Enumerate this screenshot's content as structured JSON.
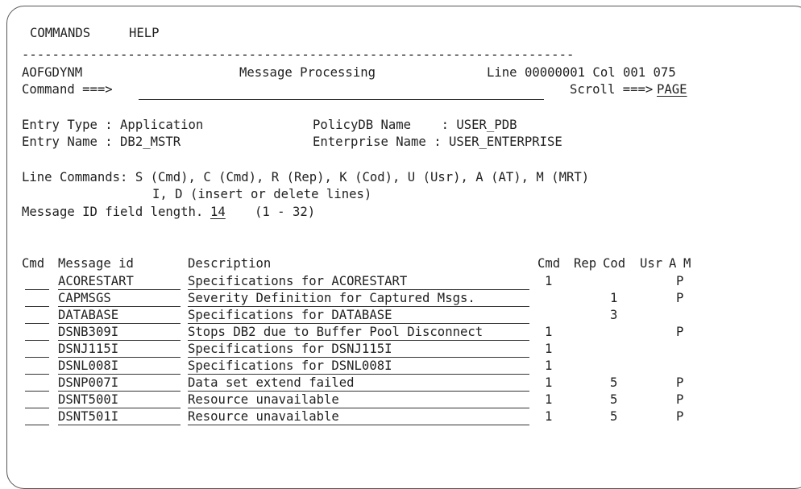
{
  "menu": {
    "commands": "COMMANDS",
    "help": "HELP"
  },
  "separator": "-------------------------------------------------------------------------",
  "header": {
    "panel_id": "AOFGDYNM",
    "title": "Message Processing",
    "position": "Line 00000001 Col 001 075",
    "command_label": "Command ===>",
    "command_value": "",
    "scroll_label": "Scroll ===>",
    "scroll_value": "PAGE"
  },
  "entry": {
    "type_label": "Entry Type : Application",
    "name_label": "Entry Name : DB2_MSTR",
    "policydb_label": "PolicyDB Name    : USER_PDB",
    "enterprise_label": "Enterprise Name : USER_ENTERPRISE"
  },
  "line_commands": {
    "line1": "Line Commands: S (Cmd), C (Cmd), R (Rep), K (Cod), U (Usr), A (AT), M (MRT)",
    "line2": "I, D (insert or delete lines)"
  },
  "msg_id_length": {
    "label": "Message ID field length. .",
    "value": "14",
    "range": "(1 - 32)"
  },
  "table": {
    "headers": {
      "cmd": "Cmd",
      "message_id": "Message id",
      "description": "Description",
      "cmd2": "Cmd",
      "rep": "Rep",
      "cod": "Cod",
      "usr": "Usr",
      "a": "A",
      "m": "M"
    },
    "rows": [
      {
        "id": "ACORESTART",
        "desc": "Specifications for ACORESTART",
        "cmd": "1",
        "cod": "",
        "a": "P"
      },
      {
        "id": "CAPMSGS",
        "desc": "Severity Definition for Captured Msgs.",
        "cmd": "",
        "cod": "1",
        "a": "P"
      },
      {
        "id": "DATABASE",
        "desc": "Specifications for DATABASE",
        "cmd": "",
        "cod": "3",
        "a": ""
      },
      {
        "id": "DSNB309I",
        "desc": "Stops DB2 due to Buffer Pool Disconnect",
        "cmd": "1",
        "cod": "",
        "a": "P"
      },
      {
        "id": "DSNJ115I",
        "desc": "Specifications for DSNJ115I",
        "cmd": "1",
        "cod": "",
        "a": ""
      },
      {
        "id": "DSNL008I",
        "desc": "Specifications for DSNL008I",
        "cmd": "1",
        "cod": "",
        "a": ""
      },
      {
        "id": "DSNP007I",
        "desc": "Data set extend failed",
        "cmd": "1",
        "cod": "5",
        "a": "P"
      },
      {
        "id": "DSNT500I",
        "desc": "Resource unavailable",
        "cmd": "1",
        "cod": "5",
        "a": "P"
      },
      {
        "id": "DSNT501I",
        "desc": "Resource unavailable",
        "cmd": "1",
        "cod": "5",
        "a": "P"
      }
    ]
  }
}
